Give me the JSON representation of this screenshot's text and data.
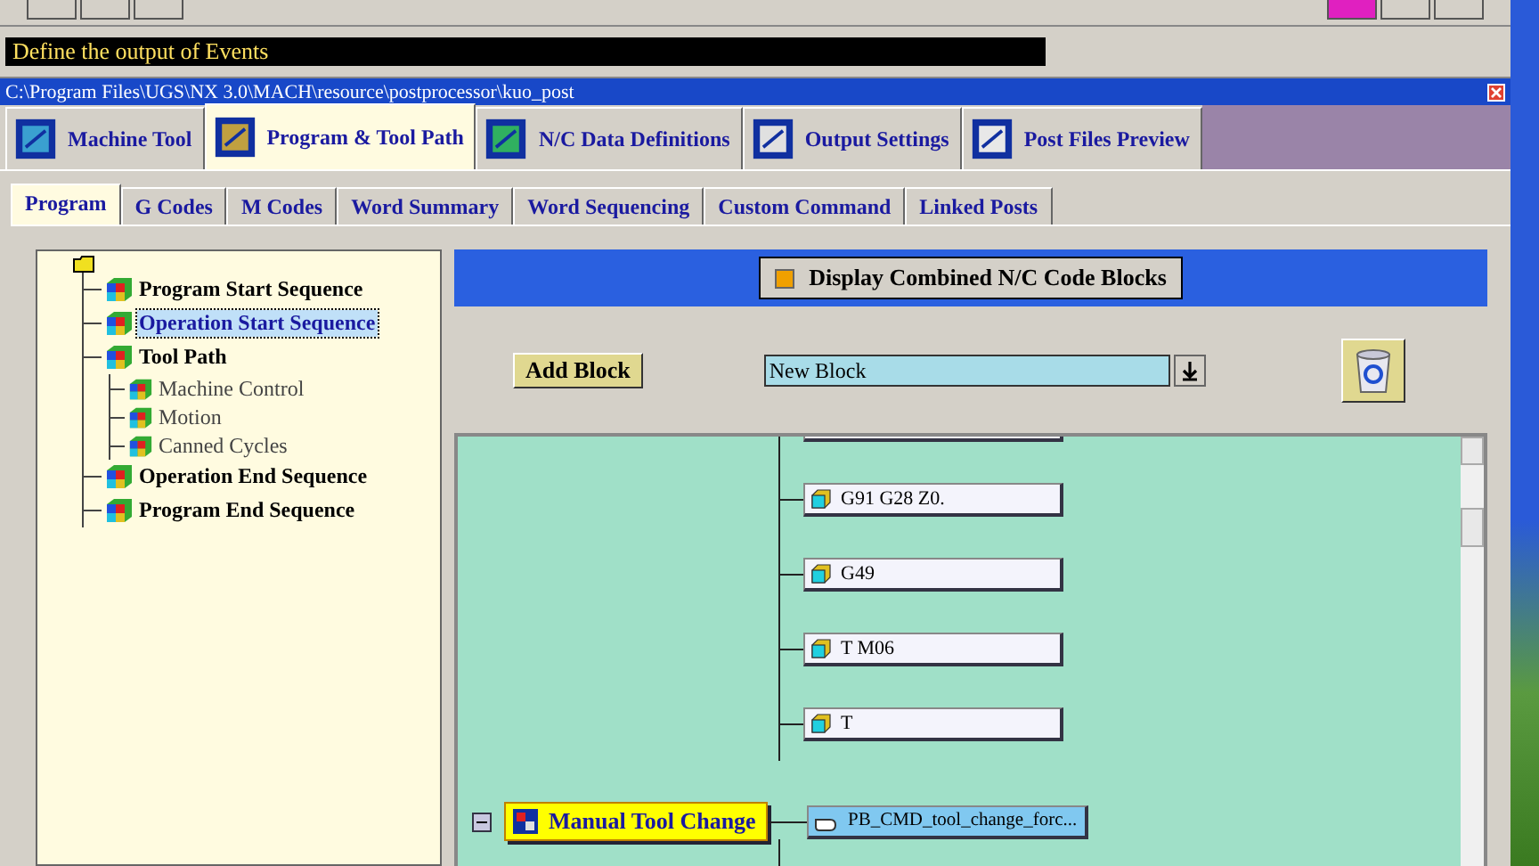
{
  "status_message": "Define the output of Events",
  "window": {
    "title": "C:\\Program Files\\UGS\\NX 3.0\\MACH\\resource\\postprocessor\\kuo_post"
  },
  "main_tabs": [
    {
      "label": "Machine Tool",
      "selected": false
    },
    {
      "label": "Program & Tool Path",
      "selected": true
    },
    {
      "label": "N/C Data Definitions",
      "selected": false
    },
    {
      "label": "Output Settings",
      "selected": false
    },
    {
      "label": "Post Files Preview",
      "selected": false
    }
  ],
  "sub_tabs": [
    {
      "label": "Program",
      "selected": true
    },
    {
      "label": "G Codes",
      "selected": false
    },
    {
      "label": "M Codes",
      "selected": false
    },
    {
      "label": "Word Summary",
      "selected": false
    },
    {
      "label": "Word Sequencing",
      "selected": false
    },
    {
      "label": "Custom Command",
      "selected": false
    },
    {
      "label": "Linked Posts",
      "selected": false
    }
  ],
  "tree": {
    "children": [
      {
        "label": "Program Start Sequence",
        "selected": false
      },
      {
        "label": "Operation Start Sequence",
        "selected": true
      },
      {
        "label": "Tool Path",
        "selected": false,
        "children": [
          {
            "label": "Machine Control",
            "selected": false
          },
          {
            "label": "Motion",
            "selected": false
          },
          {
            "label": "Canned Cycles",
            "selected": false
          }
        ]
      },
      {
        "label": "Operation End Sequence",
        "selected": false
      },
      {
        "label": "Program End Sequence",
        "selected": false
      }
    ]
  },
  "display_combined": {
    "label": "Display Combined N/C Code Blocks",
    "checked": true
  },
  "add_block_button": "Add Block",
  "block_select": {
    "value": "New Block"
  },
  "blocks": [
    {
      "label": "G91 G28 Z0."
    },
    {
      "label": "G49"
    },
    {
      "label": "T M06"
    },
    {
      "label": "T"
    }
  ],
  "event": {
    "label": "Manual Tool Change",
    "expanded": true,
    "command": "PB_CMD_tool_change_forc..."
  }
}
